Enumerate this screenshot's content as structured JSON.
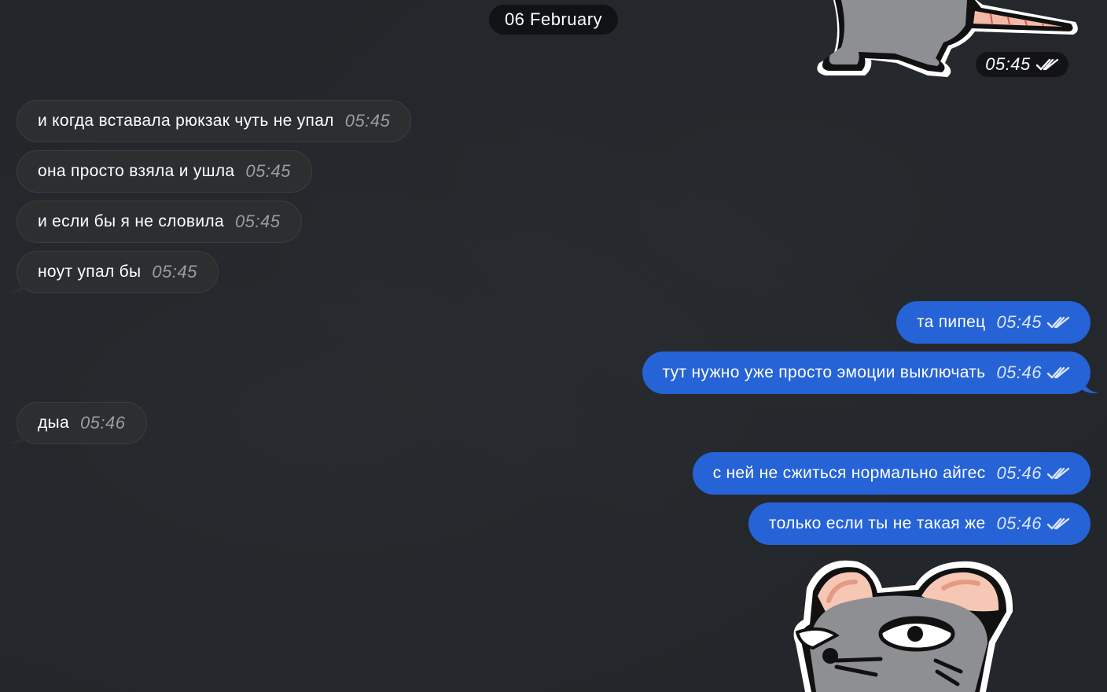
{
  "date_separator": "06 February",
  "top_sticker": {
    "time": "05:45"
  },
  "incoming": [
    {
      "text": "и когда вставала рюкзак чуть не упал",
      "time": "05:45"
    },
    {
      "text": "она просто взяла и ушла",
      "time": "05:45"
    },
    {
      "text": "и если бы я не словила",
      "time": "05:45"
    },
    {
      "text": "ноут упал бы",
      "time": "05:45"
    },
    {
      "text": "дыа",
      "time": "05:46"
    }
  ],
  "outgoing": [
    {
      "text": "та пипец",
      "time": "05:45"
    },
    {
      "text": "тут нужно уже просто эмоции выключать",
      "time": "05:46"
    },
    {
      "text": "с ней не сжиться нормально айгес",
      "time": "05:46"
    },
    {
      "text": "только если ты не такая же",
      "time": "05:46"
    }
  ],
  "colors": {
    "background": "#23262a",
    "incoming_bubble": "#2c2e30",
    "outgoing_bubble": "#2563d6",
    "date_pill": "#111214"
  },
  "icons": [
    "double-check-icon",
    "rat-sticker"
  ]
}
